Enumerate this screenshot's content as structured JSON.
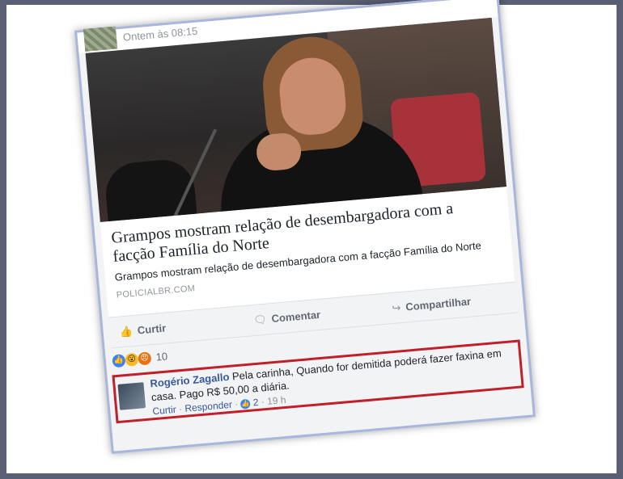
{
  "post": {
    "timestamp": "Ontem às 08:15",
    "headline": "Grampos mostram relação de desembargadora com a facção Família do Norte",
    "subtitle": "Grampos mostram relação de desembargadora com a facção Família do Norte",
    "source": "POLICIALBR.COM"
  },
  "actions": {
    "like": "Curtir",
    "comment": "Comentar",
    "share": "Compartilhar"
  },
  "reactions": {
    "count": "10",
    "icons": [
      "like-icon",
      "wow-icon",
      "angry-icon"
    ]
  },
  "comment": {
    "author": "Rogério Zagallo",
    "text": "Pela carinha, Quando for demitida poderá fazer faxina em casa. Pago R$ 50,00 a diária.",
    "like_action": "Curtir",
    "reply_action": "Responder",
    "like_count": "2",
    "time": "19 h"
  },
  "colors": {
    "highlight": "#c0202a",
    "link": "#385898",
    "frame": "#a9b6dc"
  }
}
